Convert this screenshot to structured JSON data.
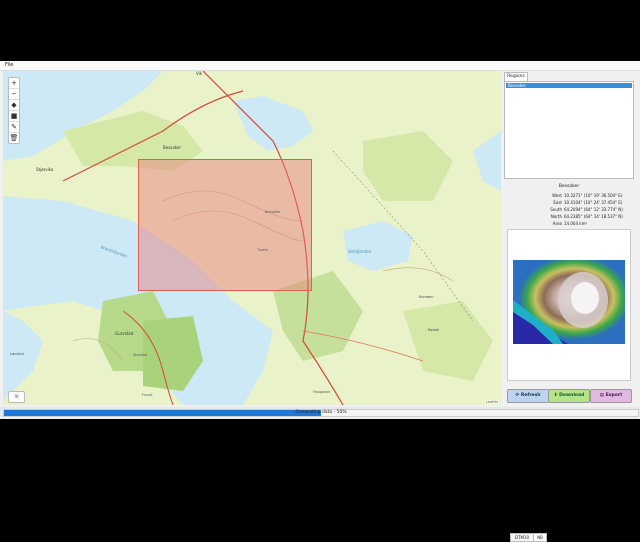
{
  "menu": {
    "file": "File"
  },
  "map": {
    "toolbar": [
      {
        "name": "zoom-in-icon",
        "glyph": "+"
      },
      {
        "name": "zoom-out-icon",
        "glyph": "−"
      },
      {
        "name": "marker-icon",
        "glyph": "◆"
      },
      {
        "name": "polygon-icon",
        "glyph": "■"
      },
      {
        "name": "edit-icon",
        "glyph": "✎"
      },
      {
        "name": "delete-icon",
        "glyph": "🗑"
      }
    ],
    "labels": {
      "vik": "Vik",
      "bessaker_north": "Bessaker",
      "stjorvika": "Stjørvika",
      "bessaker_center": "Bessaker",
      "tveite": "Tveite",
      "brandsfjorden": "Brandsfjorden",
      "vetafjorden": "Vetafjorden",
      "gurvstad": "Gurvstad",
      "lovstad": "Løvstad",
      "furvik": "Furvik",
      "haugstad": "Haugstad",
      "ramoen": "Ramøen",
      "rodde": "Rødde",
      "storvika": "Storvika"
    },
    "attribution": "Leaflet"
  },
  "panel": {
    "tab": "Regions",
    "regions": [
      "Bessaker"
    ],
    "info_title": "Bessaker",
    "info": [
      {
        "key": "West",
        "value": "10.3271° (10° 19' 36.504\" E)"
      },
      {
        "key": "East",
        "value": "10.4104° (10° 24' 37.454\" E)"
      },
      {
        "key": "South",
        "value": "64.2094° (64° 12' 33.774\" N)"
      },
      {
        "key": "North",
        "value": "64.2385° (64° 14' 18.537\" N)"
      },
      {
        "key": "Area",
        "value": "14.004 km²"
      }
    ],
    "preview_tabs": [
      "DTM10",
      "NB"
    ],
    "buttons": {
      "refresh": "Refresh",
      "download": "Download",
      "export": "Export"
    }
  },
  "status": {
    "text": "Generating data - 50%",
    "progress": 0.5
  },
  "colors": {
    "accent": "#1e78d4",
    "selection": "#e97878",
    "water": "#cde9f5",
    "land": "#eaf2c9"
  }
}
